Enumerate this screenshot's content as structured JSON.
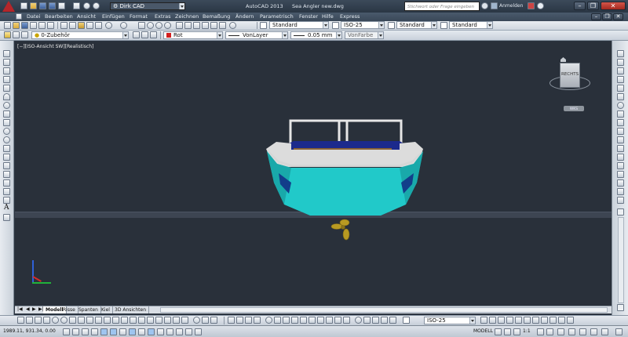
{
  "app": {
    "quick_access_profile": "Dirk CAD",
    "title": "AutoCAD 2013",
    "document": "Sea Angler new.dwg",
    "search_placeholder": "Stichwort oder Frage eingeben",
    "signin": "Anmelden",
    "minimize": "–",
    "restore": "❐",
    "close": "✕"
  },
  "menu": {
    "items": [
      "Datei",
      "Bearbeiten",
      "Ansicht",
      "Einfügen",
      "Format",
      "Extras",
      "Zeichnen",
      "Bemaßung",
      "Ändern",
      "Parametrisch",
      "Fenster",
      "Hilfe",
      "Express"
    ]
  },
  "toolbar1": {
    "text_style": "Standard",
    "dim_style": "ISO-25",
    "table_style": "Standard",
    "multileader_style": "Standard"
  },
  "toolbar2": {
    "layer": "0-Zubehör",
    "color": "Rot",
    "linetype": "VonLayer",
    "lineweight": "0.05 mm",
    "plotstyle": "VonFarbe"
  },
  "viewport": {
    "label": "[−][ISO-Ansicht SW][Realistisch]",
    "viewcube_face": "RECHTS",
    "wcs_label": "WKS"
  },
  "tabs": {
    "items": [
      "Modell",
      "Risse",
      "Spanten",
      "Kiel",
      "3D Ansichten"
    ],
    "active_index": 0
  },
  "bottom_toolbar": {
    "dim_style": "ISO-25"
  },
  "status": {
    "coordinates": "1989.11, 931.34, 0.00",
    "space": "MODELL",
    "scale": "1:1"
  },
  "colors": {
    "hull": "#21c9c9",
    "deck_trim": "#dcdcdc",
    "cockpit": "#1c2a8c",
    "propeller": "#b89a22",
    "viewport_bg": "#29303a",
    "accent_red": "#c0282a"
  }
}
